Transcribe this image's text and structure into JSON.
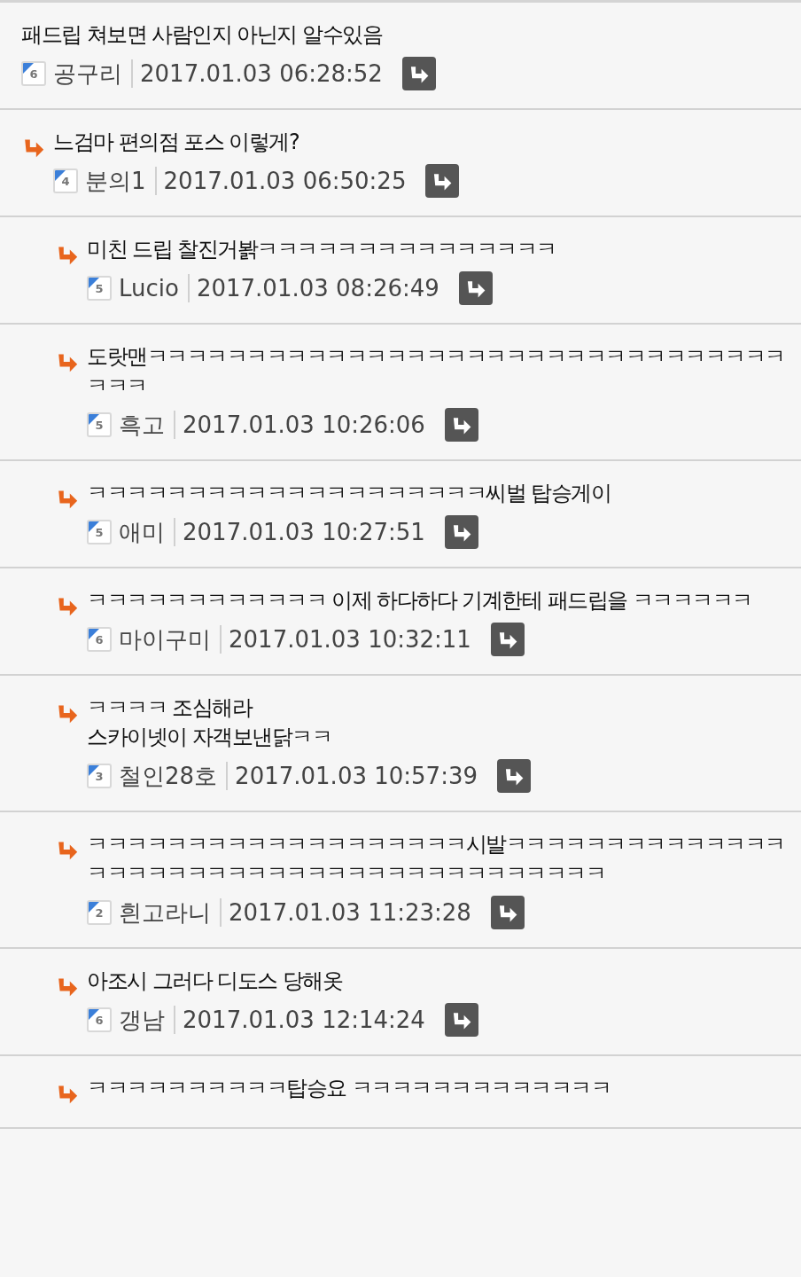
{
  "comments": [
    {
      "text": "패드립 쳐보면 사람인지 아닌지 알수있음",
      "level_badge": "6",
      "author": "공구리",
      "time": "2017.01.03 06:28:52",
      "children": [
        {
          "text": "느검마 편의점 포스 이렇게?",
          "level_badge": "4",
          "author": "분의1",
          "time": "2017.01.03 06:50:25",
          "children": [
            {
              "text": "미친 드립 찰진거봙ㅋㅋㅋㅋㅋㅋㅋㅋㅋㅋㅋㅋㅋㅋㅋ",
              "level_badge": "5",
              "author": "Lucio",
              "time": "2017.01.03 08:26:49"
            },
            {
              "text": "도랏맨ㅋㅋㅋㅋㅋㅋㅋㅋㅋㅋㅋㅋㅋㅋㅋㅋㅋㅋㅋㅋㅋㅋㅋㅋㅋㅋㅋㅋㅋㅋㅋㅋㅋㅋㅋ",
              "level_badge": "5",
              "author": "흑고",
              "time": "2017.01.03 10:26:06"
            },
            {
              "text": "ㅋㅋㅋㅋㅋㅋㅋㅋㅋㅋㅋㅋㅋㅋㅋㅋㅋㅋㅋㅋ씨벌 탑승게이",
              "level_badge": "5",
              "author": "애미",
              "time": "2017.01.03 10:27:51"
            },
            {
              "text": "ㅋㅋㅋㅋㅋㅋㅋㅋㅋㅋㅋㅋ 이제 하다하다 기계한테 패드립을 ㅋㅋㅋㅋㅋㅋ",
              "level_badge": "6",
              "author": "마이구미",
              "time": "2017.01.03 10:32:11"
            },
            {
              "text": "ㅋㅋㅋㅋ 조심해라\n스카이넷이 자객보낸닭ㅋㅋ",
              "level_badge": "3",
              "author": "철인28호",
              "time": "2017.01.03 10:57:39"
            },
            {
              "text": "ㅋㅋㅋㅋㅋㅋㅋㅋㅋㅋㅋㅋㅋㅋㅋㅋㅋㅋㅋ시발ㅋㅋㅋㅋㅋㅋㅋㅋㅋㅋㅋㅋㅋㅋㅋㅋㅋㅋㅋㅋㅋㅋㅋㅋㅋㅋㅋㅋㅋㅋㅋㅋㅋㅋㅋㅋㅋㅋㅋㅋ",
              "level_badge": "2",
              "author": "흰고라니",
              "time": "2017.01.03 11:23:28"
            },
            {
              "text": "아조시 그러다 디도스 당해옷",
              "level_badge": "6",
              "author": "갱남",
              "time": "2017.01.03 12:14:24"
            },
            {
              "text": "ㅋㅋㅋㅋㅋㅋㅋㅋㅋㅋ탑승요 ㅋㅋㅋㅋㅋㅋㅋㅋㅋㅋㅋㅋㅋ"
            }
          ]
        }
      ]
    }
  ]
}
